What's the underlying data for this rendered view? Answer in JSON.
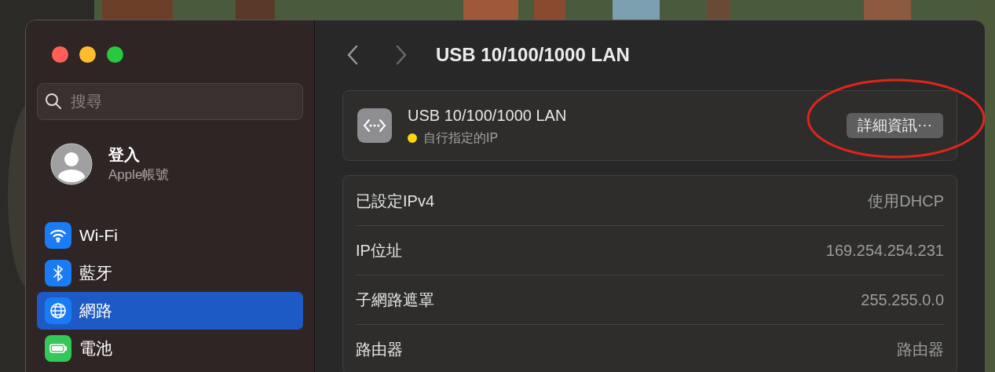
{
  "window": {
    "traffic_lights": [
      {
        "color": "#ff5f57"
      },
      {
        "color": "#febc2e"
      },
      {
        "color": "#28c840"
      }
    ]
  },
  "sidebar": {
    "search": {
      "placeholder": "搜尋"
    },
    "account": {
      "title": "登入",
      "subtitle": "Apple帳號"
    },
    "items": [
      {
        "label": "Wi-Fi",
        "kind": "wifi",
        "selected": false
      },
      {
        "label": "藍牙",
        "kind": "bluetooth",
        "selected": false
      },
      {
        "label": "網路",
        "kind": "network",
        "selected": true
      },
      {
        "label": "電池",
        "kind": "battery",
        "selected": false
      }
    ]
  },
  "main": {
    "title": "USB 10/100/1000 LAN",
    "device": {
      "name": "USB 10/100/1000 LAN",
      "status": {
        "text": "自行指定的IP",
        "color": "#ffd60a"
      },
      "button": "詳細資訊⋯"
    },
    "rows": [
      {
        "label": "已設定IPv4",
        "value": "使用DHCP"
      },
      {
        "label": "IP位址",
        "value": "169.254.254.231"
      },
      {
        "label": "子網路遮罩",
        "value": "255.255.0.0"
      },
      {
        "label": "路由器",
        "value": "路由器"
      }
    ]
  }
}
